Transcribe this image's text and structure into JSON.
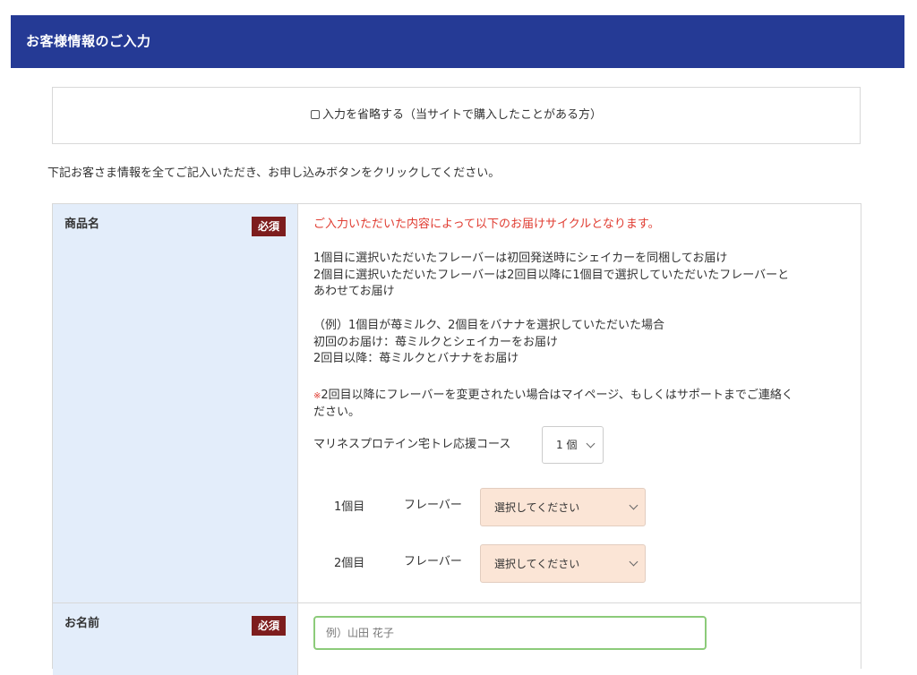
{
  "header": {
    "title": "お客様情報のご入力"
  },
  "skip": {
    "label": "入力を省略する（当サイトで購入したことがある方）",
    "checked": false
  },
  "intro": "下記お客さま情報を全てご記入いただき、お申し込みボタンをクリックしてください。",
  "product": {
    "label": "商品名",
    "required": "必須",
    "notice": "ご入力いただいた内容によって以下のお届けサイクルとなります。",
    "desc1": "1個目に選択いただいたフレーバーは初回発送時にシェイカーを同梱してお届け",
    "desc2": "2個目に選択いただいたフレーバーは2回目以降に1個目で選択していただいたフレーバーと",
    "desc3": "あわせてお届け",
    "example1": "（例）1個目が苺ミルク、2個目をバナナを選択していただいた場合",
    "example2": "初回のお届け：苺ミルクとシェイカーをお届け",
    "example3": "2回目以降：苺ミルクとバナナをお届け",
    "note_mark": "※",
    "note1": "2回目以降にフレーバーを変更されたい場合はマイページ、もしくはサポートまでご連絡く",
    "note2": "ださい。",
    "course_label": "マリネスプロテイン宅トレ応援コース",
    "quantity": "1 個",
    "items": [
      {
        "label": "1個目",
        "flavor_label": "フレーバー",
        "selected": "選択してください"
      },
      {
        "label": "2個目",
        "flavor_label": "フレーバー",
        "selected": "選択してください"
      }
    ]
  },
  "name": {
    "label": "お名前",
    "required": "必須",
    "placeholder": "例）山田 花子"
  },
  "colors": {
    "header_bg": "#253a95",
    "label_bg": "#e3edfa",
    "required_bg": "#7d1d1d",
    "notice_text": "#e03c31",
    "flavor_select_bg": "#fbe5d6",
    "input_border": "#8ccb7a"
  }
}
